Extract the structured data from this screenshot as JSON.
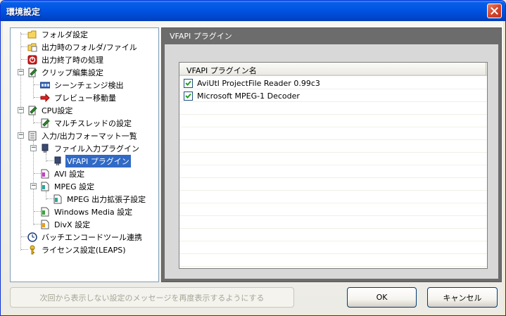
{
  "window": {
    "title": "環境設定"
  },
  "tree": [
    {
      "label": "フォルダ設定",
      "icon": "folder-icon"
    },
    {
      "label": "出力時のフォルダ/ファイル",
      "icon": "folder-file-icon"
    },
    {
      "label": "出力終了時の処理",
      "icon": "power-icon"
    },
    {
      "label": "クリップ編集設定",
      "icon": "clip-edit-icon"
    },
    {
      "label": "シーンチェンジ検出",
      "icon": "film-icon"
    },
    {
      "label": "プレビュー移動量",
      "icon": "arrow-icon"
    },
    {
      "label": "CPU設定",
      "icon": "cpu-icon"
    },
    {
      "label": "マルチスレッドの設定",
      "icon": "thread-icon"
    },
    {
      "label": "入力/出力フォーマット一覧",
      "icon": "list-icon"
    },
    {
      "label": "ファイル入力プラグイン",
      "icon": "plugin-icon"
    },
    {
      "label": "VFAPI プラグイン",
      "icon": "plugin-icon"
    },
    {
      "label": "AVI 設定",
      "icon": "avi-doc-icon"
    },
    {
      "label": "MPEG 設定",
      "icon": "mpeg-doc-icon"
    },
    {
      "label": "MPEG 出力拡張子設定",
      "icon": "mpeg-doc-icon"
    },
    {
      "label": "Windows Media 設定",
      "icon": "wmv-doc-icon"
    },
    {
      "label": "DivX 設定",
      "icon": "divx-doc-icon"
    },
    {
      "label": "バッチエンコードツール連携",
      "icon": "clock-icon"
    },
    {
      "label": "ライセンス設定(LEAPS)",
      "icon": "key-icon"
    }
  ],
  "panel": {
    "title": "VFAPI プラグイン",
    "column_header": "VFAPI プラグイン名",
    "plugins": [
      {
        "name": "AviUtl ProjectFile Reader 0.99c3",
        "checked": true
      },
      {
        "name": "Microsoft MPEG-1 Decoder",
        "checked": true
      }
    ]
  },
  "buttons": {
    "reset_messages": "次回から表示しない設定のメッセージを再度表示するようにする",
    "ok": "OK",
    "cancel": "キャンセル"
  }
}
